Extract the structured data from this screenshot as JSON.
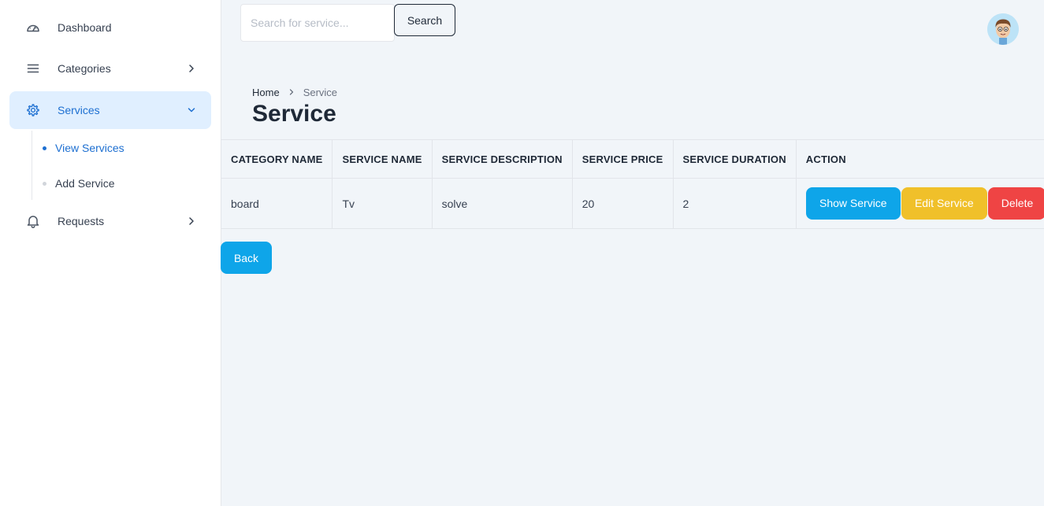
{
  "sidebar": {
    "items": [
      {
        "label": "Dashboard",
        "icon": "gauge-icon"
      },
      {
        "label": "Categories",
        "icon": "list-icon"
      },
      {
        "label": "Services",
        "icon": "gear-icon"
      },
      {
        "label": "Requests",
        "icon": "bell-icon"
      }
    ],
    "services_sub": [
      {
        "label": "View Services"
      },
      {
        "label": "Add Service"
      }
    ]
  },
  "topbar": {
    "search_placeholder": "Search for service...",
    "search_button": "Search"
  },
  "breadcrumb": {
    "home": "Home",
    "current": "Service"
  },
  "page_title": "Service",
  "table": {
    "headers": [
      "CATEGORY NAME",
      "SERVICE NAME",
      "SERVICE DESCRIPTION",
      "SERVICE PRICE",
      "SERVICE DURATION",
      "ACTION"
    ],
    "rows": [
      {
        "category": "board",
        "name": "Tv",
        "description": "solve",
        "price": "20",
        "duration": "2"
      }
    ],
    "actions": {
      "show": "Show Service",
      "edit": "Edit Service",
      "delete": "Delete"
    }
  },
  "back_button": "Back",
  "colors": {
    "accent": "#1d6fd1",
    "active_bg": "#e0efff",
    "show_button": "#0ea5e9",
    "edit_button": "#f0c02a",
    "delete_button": "#ef4444",
    "page_bg": "#f1f5f9"
  }
}
